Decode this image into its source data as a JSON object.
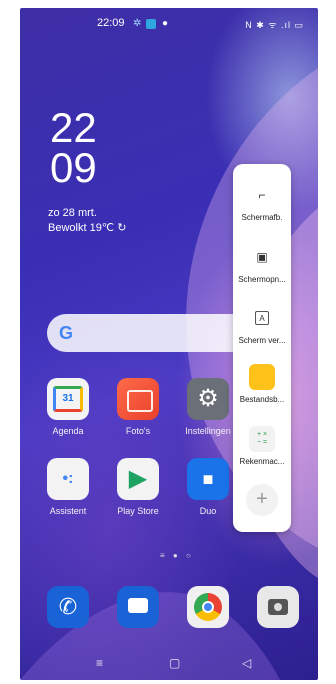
{
  "status_bar": {
    "time": "22:09",
    "right_icons": "N ✱ ᯤ .ıl ▭"
  },
  "clock": {
    "hour": "22",
    "minute": "09"
  },
  "date_widget": {
    "date": "zo 28 mrt.",
    "weather": "Bewolkt 19℃ ↻"
  },
  "search_bar": {
    "logo": "G"
  },
  "apps_row1": [
    {
      "label": "Agenda",
      "glyph": "31"
    },
    {
      "label": "Foto's",
      "glyph": ""
    },
    {
      "label": "Instellingen",
      "glyph": "⚙"
    }
  ],
  "apps_row2": [
    {
      "label": "Assistent",
      "glyph": "•:"
    },
    {
      "label": "Play Store",
      "glyph": "▶"
    },
    {
      "label": "Duo",
      "glyph": "■"
    }
  ],
  "page_indicator": "≡ ● ○",
  "dock": [
    "phone-icon",
    "messages-icon",
    "chrome-icon",
    "camera-icon"
  ],
  "side_panel": {
    "items": [
      {
        "label": "Schermafb.",
        "glyph": "⌐"
      },
      {
        "label": "Schermopn...",
        "glyph": "▣"
      },
      {
        "label": "Scherm ver...",
        "glyph": "A"
      },
      {
        "label": "Bestandsb...",
        "glyph": ""
      },
      {
        "label": "Rekenmac...",
        "glyph": "+ ×\n− ="
      }
    ],
    "add": "+"
  },
  "nav_bar": {
    "menu": "≡",
    "home": "▢",
    "back": "◁"
  }
}
